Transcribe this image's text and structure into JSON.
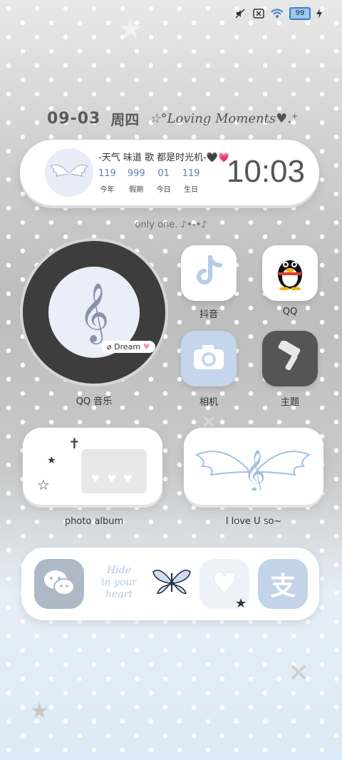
{
  "status_bar": {
    "battery_level": "99",
    "icons": [
      "mute-icon",
      "sim-blocked-icon",
      "wifi-icon",
      "battery-icon",
      "charging-icon"
    ]
  },
  "date_row": {
    "date": "09-03",
    "weekday": "周四",
    "tagline": "☆°Loving Moments♥.⁺"
  },
  "wide_widget": {
    "tagline": "-天气 味道 歌 都是时光机-🖤💗",
    "stats": [
      {
        "number": "119",
        "label": "今年"
      },
      {
        "number": "999",
        "label": "假期"
      },
      {
        "number": "01",
        "label": "今日"
      },
      {
        "number": "119",
        "label": "生日"
      }
    ],
    "time": "10:03"
  },
  "subtitle": "only one. ♪•˖•♪ ",
  "music_widget": {
    "badge": "Dream",
    "label": "QQ 音乐"
  },
  "apps": [
    {
      "name": "抖音",
      "icon": "douyin-icon"
    },
    {
      "name": "QQ",
      "icon": "qq-penguin-icon"
    },
    {
      "name": "相机",
      "icon": "camera-icon"
    },
    {
      "name": "主题",
      "icon": "theme-brush-icon"
    }
  ],
  "photo_album": {
    "label": "photo album"
  },
  "love_widget": {
    "label": "I love U so~"
  },
  "dock": {
    "hide_text": [
      "Hide",
      "in your",
      "heart"
    ],
    "items": [
      "wechat-icon",
      "hide-in-your-heart-widget",
      "butterfly-icon",
      "heart-bubble-icon",
      "alipay-icon"
    ]
  },
  "colors": {
    "accent_blue": "#5c84b6",
    "icon_blue": "#b6cbe8",
    "text_gray": "#555555"
  }
}
